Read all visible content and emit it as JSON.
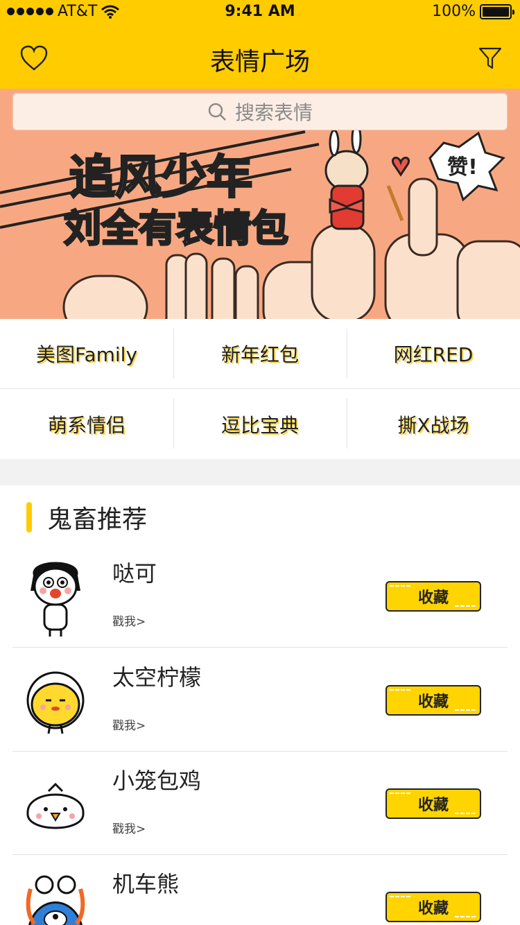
{
  "status_bar": {
    "carrier": "AT&T",
    "time": "9:41 AM",
    "battery": "100%"
  },
  "header": {
    "title": "表情广场"
  },
  "search": {
    "placeholder": "搜索表情"
  },
  "banner": {
    "line1": "追风少年",
    "line2": "刘全有表情包",
    "badge": "赞!"
  },
  "categories": [
    {
      "label": "美图Family"
    },
    {
      "label": "新年红包"
    },
    {
      "label": "网红RED"
    },
    {
      "label": "萌系情侣"
    },
    {
      "label": "逗比宝典"
    },
    {
      "label": "撕X战场"
    }
  ],
  "section": {
    "title": "鬼畜推荐"
  },
  "items": [
    {
      "name": "哒可",
      "sub": "戳我>",
      "button": "收藏"
    },
    {
      "name": "太空柠檬",
      "sub": "戳我>",
      "button": "收藏"
    },
    {
      "name": "小笼包鸡",
      "sub": "戳我>",
      "button": "收藏"
    },
    {
      "name": "机车熊",
      "sub": "",
      "button": "收藏"
    }
  ],
  "colors": {
    "brand_yellow": "#ffcc00",
    "banner_bg": "#f7a882"
  }
}
